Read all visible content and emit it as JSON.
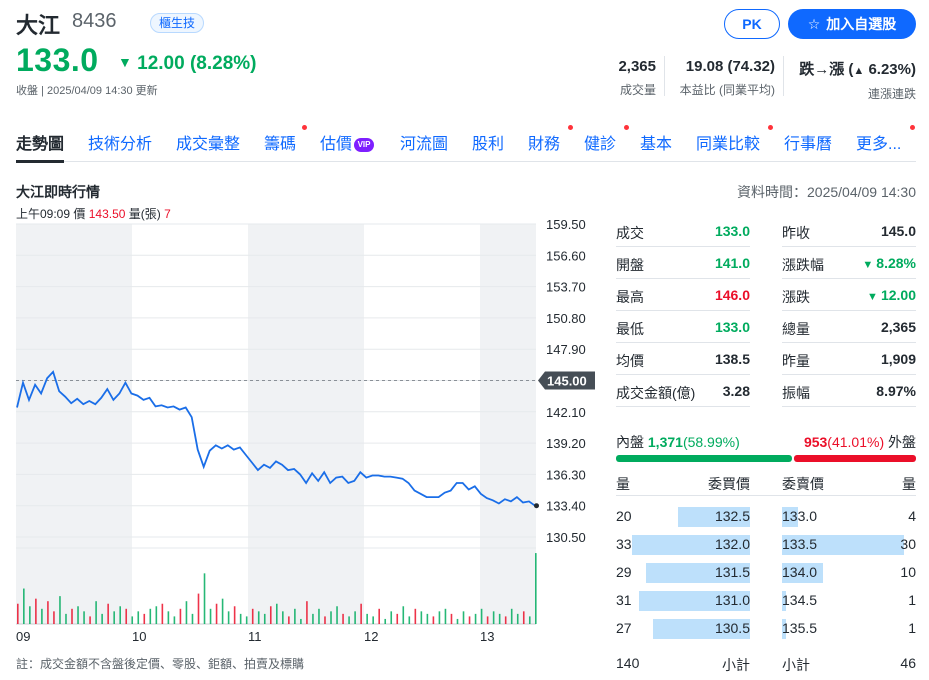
{
  "header": {
    "name": "大江",
    "code": "8436",
    "market": "櫃生技",
    "price": "133.0",
    "change": "12.00 (8.28%)",
    "update_time": "收盤 | 2025/04/09 14:30 更新",
    "pk_label": "PK",
    "add_watchlist_label": "加入自選股"
  },
  "stats": [
    {
      "value": "2,365",
      "label": "成交量"
    },
    {
      "value": "19.08 (74.32)",
      "label": "本益比 (同業平均)"
    },
    {
      "value_prefix": "跌→漲",
      "value_suffix": "6.23%",
      "label": "連漲連跌"
    }
  ],
  "tabs": [
    {
      "label": "走勢圖",
      "active": true,
      "dot": false
    },
    {
      "label": "技術分析",
      "dot": false
    },
    {
      "label": "成交彙整",
      "dot": false
    },
    {
      "label": "籌碼",
      "dot": true
    },
    {
      "label": "估價",
      "vip": "VIP",
      "dot": false
    },
    {
      "label": "河流圖",
      "dot": false
    },
    {
      "label": "股利",
      "dot": false
    },
    {
      "label": "財務",
      "dot": true
    },
    {
      "label": "健診",
      "dot": true
    },
    {
      "label": "基本",
      "dot": false
    },
    {
      "label": "同業比較",
      "dot": true
    },
    {
      "label": "行事曆",
      "dot": false
    },
    {
      "label": "更多...",
      "dot": true
    }
  ],
  "section": {
    "title": "大江即時行情",
    "data_time": "資料時間：2025/04/09 14:30"
  },
  "hover": {
    "time": "上午09:09",
    "price_label": "價",
    "price": "143.50",
    "volume_label": "量(張)",
    "volume": "7"
  },
  "chart_data": {
    "type": "line",
    "y_ticks": [
      "159.50",
      "156.60",
      "153.70",
      "150.80",
      "147.90",
      "145.00",
      "142.10",
      "139.20",
      "136.30",
      "133.40",
      "130.50"
    ],
    "ylim": [
      130.5,
      159.5
    ],
    "x_ticks": [
      "09",
      "10",
      "11",
      "12",
      "13"
    ],
    "reference_price": 145.0,
    "reference_label": "145.00",
    "last_price": 133.4,
    "price_series": [
      142.5,
      144.8,
      143.2,
      144.6,
      143.8,
      145.2,
      145.8,
      144.0,
      143.5,
      142.9,
      143.3,
      142.8,
      143.1,
      142.8,
      143.4,
      144.2,
      143.2,
      143.8,
      144.8,
      143.8,
      143.6,
      143.2,
      143.4,
      142.6,
      142.7,
      142.5,
      142.6,
      142.3,
      142.5,
      141.6,
      138.6,
      137.0,
      138.5,
      139.0,
      138.7,
      139.0,
      138.6,
      138.8,
      138.1,
      137.4,
      136.7,
      137.2,
      136.9,
      137.5,
      137.2,
      136.7,
      136.8,
      136.3,
      135.5,
      136.4,
      135.7,
      136.5,
      135.5,
      136.0,
      136.1,
      135.5,
      135.7,
      136.5,
      136.0,
      136.2,
      136.2,
      136.1,
      136.1,
      136.0,
      135.9,
      135.5,
      134.8,
      134.5,
      134.2,
      134.2,
      134.2,
      134.6,
      134.8,
      135.5,
      135.5,
      134.9,
      135.2,
      134.5,
      134.1,
      133.9,
      133.6,
      134.0,
      133.8,
      134.2,
      133.7,
      133.8,
      133.4
    ],
    "volume_series": [
      8,
      14,
      7,
      10,
      6,
      9,
      5,
      11,
      4,
      6,
      7,
      5,
      3,
      9,
      4,
      8,
      5,
      7,
      6,
      3,
      5,
      4,
      6,
      7,
      8,
      5,
      3,
      6,
      9,
      4,
      12,
      20,
      6,
      8,
      10,
      5,
      7,
      4,
      3,
      6,
      5,
      4,
      7,
      8,
      5,
      3,
      6,
      2,
      9,
      4,
      6,
      3,
      5,
      7,
      4,
      3,
      5,
      8,
      4,
      3,
      6,
      2,
      5,
      4,
      7,
      3,
      6,
      5,
      4,
      3,
      5,
      6,
      4,
      2,
      5,
      3,
      4,
      6,
      3,
      5,
      4,
      3,
      6,
      4,
      5,
      3,
      28
    ],
    "volume_max": 30
  },
  "chart_note": "註：成交金額不含盤後定價、零股、鉅額、拍賣及標購",
  "quote_table": {
    "left": [
      {
        "label": "成交",
        "value": "133.0",
        "color": "green"
      },
      {
        "label": "開盤",
        "value": "141.0",
        "color": "green"
      },
      {
        "label": "最高",
        "value": "146.0",
        "color": "red"
      },
      {
        "label": "最低",
        "value": "133.0",
        "color": "green"
      },
      {
        "label": "均價",
        "value": "138.5",
        "color": "black"
      },
      {
        "label": "成交金額(億)",
        "value": "3.28",
        "color": "black"
      }
    ],
    "right": [
      {
        "label": "昨收",
        "value": "145.0",
        "color": "black"
      },
      {
        "label": "漲跌幅",
        "value": "8.28%",
        "color": "green",
        "arrow": "down"
      },
      {
        "label": "漲跌",
        "value": "12.00",
        "color": "green",
        "arrow": "down"
      },
      {
        "label": "總量",
        "value": "2,365",
        "color": "black"
      },
      {
        "label": "昨量",
        "value": "1,909",
        "color": "black"
      },
      {
        "label": "振幅",
        "value": "8.97%",
        "color": "black"
      }
    ]
  },
  "inner_outer": {
    "inner_label": "內盤",
    "inner_value": "1,371",
    "inner_pct": "(58.99%)",
    "inner_fraction": 0.5899,
    "outer_value": "953",
    "outer_pct": "(41.01%)",
    "outer_label": "外盤"
  },
  "order_book": {
    "headers": {
      "bid_qty": "量",
      "bid_price": "委買價",
      "ask_price": "委賣價",
      "ask_qty": "量"
    },
    "bids": [
      {
        "qty": "20",
        "price": "132.5",
        "qty_num": 20
      },
      {
        "qty": "33",
        "price": "132.0",
        "qty_num": 33
      },
      {
        "qty": "29",
        "price": "131.5",
        "qty_num": 29
      },
      {
        "qty": "31",
        "price": "131.0",
        "qty_num": 31
      },
      {
        "qty": "27",
        "price": "130.5",
        "qty_num": 27
      }
    ],
    "asks": [
      {
        "price": "133.0",
        "qty": "4",
        "qty_num": 4
      },
      {
        "price": "133.5",
        "qty": "30",
        "qty_num": 30
      },
      {
        "price": "134.0",
        "qty": "10",
        "qty_num": 10
      },
      {
        "price": "134.5",
        "qty": "1",
        "qty_num": 1
      },
      {
        "price": "135.5",
        "qty": "1",
        "qty_num": 1
      }
    ],
    "bid_total": "140",
    "bid_total_label": "小計",
    "ask_total_label": "小計",
    "ask_total": "46",
    "max_qty": 33
  },
  "colors": {
    "up": "#eb0f29",
    "down": "#00ab5e",
    "accent": "#0f69ff",
    "line": "#1a6ee8"
  }
}
